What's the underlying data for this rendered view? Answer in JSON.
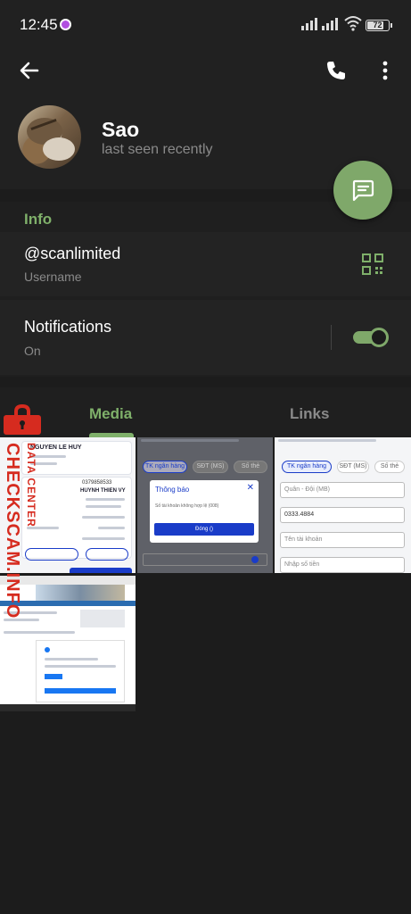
{
  "status_bar": {
    "time": "12:45",
    "battery": "72"
  },
  "header": {
    "name": "Sao",
    "last_seen": "last seen recently"
  },
  "info": {
    "title": "Info",
    "username": "@scanlimited",
    "username_label": "Username",
    "notifications_label": "Notifications",
    "notifications_value": "On",
    "notifications_enabled": true
  },
  "tabs": [
    {
      "label": "Media",
      "active": true
    },
    {
      "label": "Links",
      "active": false
    }
  ],
  "media": {
    "thumb1": {
      "name_text": "NGUYEN LE HUY",
      "amount": "0379858533",
      "recipient": "HUYNH THIEN VY"
    },
    "thumb2": {
      "dialog_title": "Thông báo",
      "dialog_message": "Số tài khoản không hợp lệ (008)",
      "dialog_button": "Đóng ()",
      "tab1": "TK ngân hàng",
      "tab2": "SĐT (MS)",
      "tab3": "Số thẻ"
    },
    "thumb3": {
      "tab1": "TK ngân hàng",
      "tab2": "SĐT (MS)",
      "tab3": "Số thẻ",
      "bank": "Quân - Đội (MB)",
      "account": "0333.4884",
      "placeholder_name": "Tên tài khoản",
      "placeholder_amount": "Nhập số tiền"
    }
  },
  "watermark": {
    "line1": "DATA CENTER",
    "line2": "CHECKSCAM.INFO"
  },
  "colors": {
    "accent": "#7fb06a",
    "background": "#1c1c1c",
    "fab": "#7fa86a",
    "watermark": "#d62b1f"
  }
}
